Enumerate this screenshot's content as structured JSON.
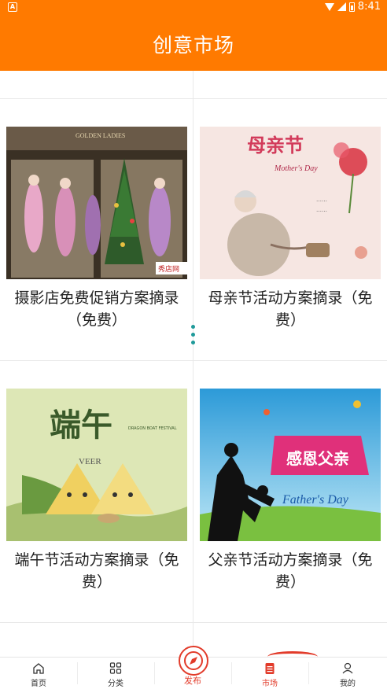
{
  "status_bar": {
    "app_badge": "A",
    "time": "8:41"
  },
  "header": {
    "title": "创意市场"
  },
  "cards": [
    {
      "title": "摄影店免费促销方案摘录（免费）",
      "image": "shop-window-with-dresses"
    },
    {
      "title": "母亲节活动方案摘录（免费）",
      "image": "mothers-day-poster"
    },
    {
      "title": "端午节活动方案摘录（免费）",
      "image": "dragon-boat-festival-poster"
    },
    {
      "title": "父亲节活动方案摘录（免费）",
      "image": "fathers-day-poster"
    }
  ],
  "images": {
    "shop_sign": "GOLDEN LADIES",
    "shop_watermark": "秀店网",
    "mothers_title": "母亲节",
    "mothers_sub": "Mother's Day",
    "dragon_title": "端午",
    "dragon_sub": "DRAGON BOAT FESTIVAL",
    "dragon_brand": "VEER",
    "fathers_title": "感恩父亲",
    "fathers_sub": "Father's Day"
  },
  "tabs": [
    {
      "label": "首页",
      "icon": "home-icon"
    },
    {
      "label": "分类",
      "icon": "category-grid-icon"
    },
    {
      "label": "发布",
      "icon": "compass-icon"
    },
    {
      "label": "市场",
      "icon": "document-icon"
    },
    {
      "label": "我的",
      "icon": "profile-icon"
    }
  ],
  "colors": {
    "primary": "#ff7a00",
    "accent_red": "#e23b2a",
    "scroll_dots": "#1f9a9a"
  }
}
